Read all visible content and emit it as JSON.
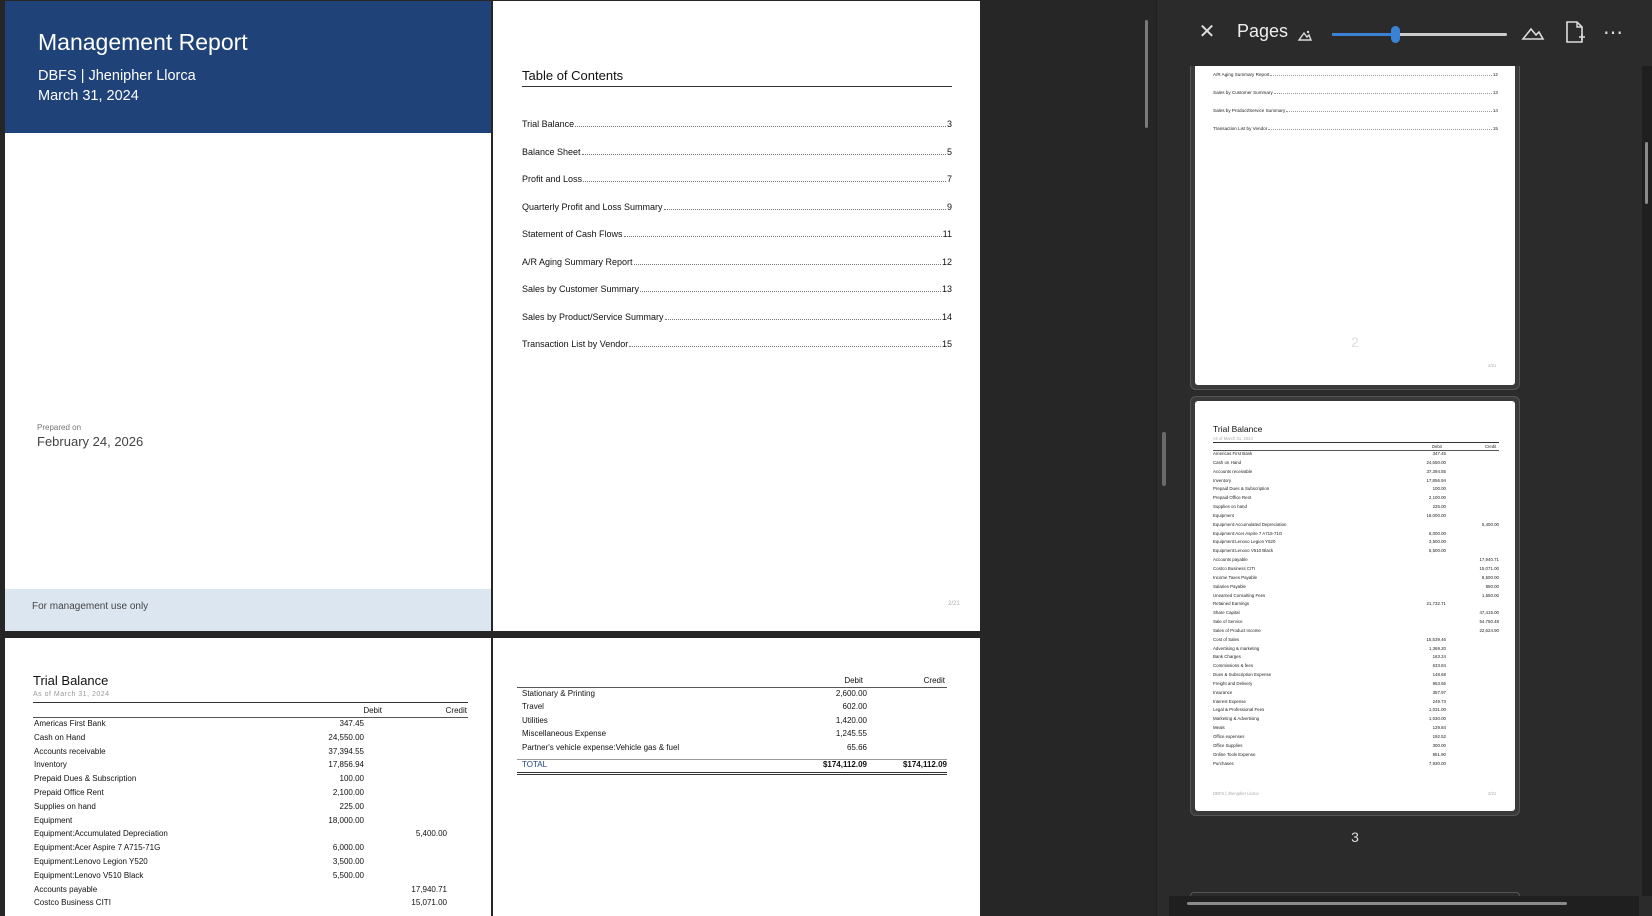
{
  "cover": {
    "title": "Management Report",
    "subtitle": "DBFS | Jhenipher Llorca",
    "date": "March 31, 2024",
    "prepared_label": "Prepared on",
    "prepared_date": "February 24, 2026",
    "footer": "For management use only"
  },
  "toc": {
    "title": "Table of Contents",
    "entries": [
      {
        "label": "Trial Balance",
        "page": "3"
      },
      {
        "label": "Balance Sheet",
        "page": "5"
      },
      {
        "label": "Profit and Loss",
        "page": "7"
      },
      {
        "label": "Quarterly Profit and Loss Summary",
        "page": "9"
      },
      {
        "label": "Statement of Cash Flows",
        "page": "11"
      },
      {
        "label": "A/R Aging Summary Report",
        "page": "12"
      },
      {
        "label": "Sales by Customer Summary",
        "page": "13"
      },
      {
        "label": "Sales by Product/Service Summary",
        "page": "14"
      },
      {
        "label": "Transaction List by Vendor",
        "page": "15"
      }
    ],
    "page_num": "2/21"
  },
  "trial_balance": {
    "title": "Trial Balance",
    "as_of": "As of March 31, 2024",
    "col_debit": "Debit",
    "col_credit": "Credit",
    "rows": [
      {
        "name": "Americas First Bank",
        "debit": "347.45",
        "credit": ""
      },
      {
        "name": "Cash on Hand",
        "debit": "24,550.00",
        "credit": ""
      },
      {
        "name": "Accounts receivable",
        "debit": "37,394.55",
        "credit": ""
      },
      {
        "name": "Inventory",
        "debit": "17,856.94",
        "credit": ""
      },
      {
        "name": "Prepaid Dues & Subscription",
        "debit": "100.00",
        "credit": ""
      },
      {
        "name": "Prepaid Office Rent",
        "debit": "2,100.00",
        "credit": ""
      },
      {
        "name": "Supplies on hand",
        "debit": "225.00",
        "credit": ""
      },
      {
        "name": "Equipment",
        "debit": "18,000.00",
        "credit": ""
      },
      {
        "name": "Equipment:Accumulated Depreciation",
        "debit": "",
        "credit": "5,400.00"
      },
      {
        "name": "Equipment:Acer Aspire 7 A715-71G",
        "debit": "6,000.00",
        "credit": ""
      },
      {
        "name": "Equipment:Lenovo Legion Y520",
        "debit": "3,500.00",
        "credit": ""
      },
      {
        "name": "Equipment:Lenovo V510 Black",
        "debit": "5,500.00",
        "credit": ""
      },
      {
        "name": "Accounts payable",
        "debit": "",
        "credit": "17,940.71"
      },
      {
        "name": "Costco Business CITI",
        "debit": "",
        "credit": "15,071.00"
      }
    ]
  },
  "trial_balance_cont": {
    "col_debit": "Debit",
    "col_credit": "Credit",
    "rows": [
      {
        "name": "Stationary & Printing",
        "debit": "2,600.00",
        "credit": ""
      },
      {
        "name": "Travel",
        "debit": "602.00",
        "credit": ""
      },
      {
        "name": "Utilities",
        "debit": "1,420.00",
        "credit": ""
      },
      {
        "name": "Miscellaneous Expense",
        "debit": "1,245.55",
        "credit": ""
      },
      {
        "name": "Partner's vehicle expense:Vehicle gas & fuel",
        "debit": "65.66",
        "credit": ""
      }
    ],
    "total": {
      "name": "TOTAL",
      "debit": "$174,112.09",
      "credit": "$174,112.09"
    }
  },
  "panel": {
    "title": "Pages",
    "zoom_fraction": 0.36,
    "thumb2_label": "2",
    "thumb3_label": "3",
    "thumb2_entries": [
      {
        "label": "A/R Aging Summary Report",
        "page": "12"
      },
      {
        "label": "Sales by Customer Summary",
        "page": "13"
      },
      {
        "label": "Sales by Product/Service Summary",
        "page": "14"
      },
      {
        "label": "Transaction List by Vendor",
        "page": "15"
      }
    ],
    "thumb2_pagenum": "2/21",
    "thumb3_title": "Trial Balance",
    "thumb3_asof": "As of March 31, 2024",
    "thumb3_debit": "Debit",
    "thumb3_credit": "Credit",
    "thumb3_rows": [
      {
        "name": "Americas First Bank",
        "debit": "347.45",
        "credit": ""
      },
      {
        "name": "Cash on Hand",
        "debit": "24,550.00",
        "credit": ""
      },
      {
        "name": "Accounts receivable",
        "debit": "37,394.55",
        "credit": ""
      },
      {
        "name": "Inventory",
        "debit": "17,856.94",
        "credit": ""
      },
      {
        "name": "Prepaid Dues & Subscription",
        "debit": "100.00",
        "credit": ""
      },
      {
        "name": "Prepaid Office Rent",
        "debit": "2,100.00",
        "credit": ""
      },
      {
        "name": "Supplies on hand",
        "debit": "225.00",
        "credit": ""
      },
      {
        "name": "Equipment",
        "debit": "18,000.00",
        "credit": ""
      },
      {
        "name": "Equipment:Accumulated Depreciation",
        "debit": "",
        "credit": "5,400.00"
      },
      {
        "name": "Equipment:Acer Aspire 7 A715-71G",
        "debit": "6,000.00",
        "credit": ""
      },
      {
        "name": "Equipment:Lenovo Legion Y520",
        "debit": "3,500.00",
        "credit": ""
      },
      {
        "name": "Equipment:Lenovo V510 Black",
        "debit": "5,500.00",
        "credit": ""
      },
      {
        "name": "Accounts payable",
        "debit": "",
        "credit": "17,940.71"
      },
      {
        "name": "Costco Business CITI",
        "debit": "",
        "credit": "15,071.00"
      },
      {
        "name": "Income Taxes Payable",
        "debit": "",
        "credit": "8,500.00"
      },
      {
        "name": "Salaries Payable",
        "debit": "",
        "credit": "850.00"
      },
      {
        "name": "Unearned Consulting Fees",
        "debit": "",
        "credit": "1,550.00"
      },
      {
        "name": "Retained Earnings",
        "debit": "21,732.71",
        "credit": ""
      },
      {
        "name": "Share Capital",
        "debit": "",
        "credit": "47,415.00"
      },
      {
        "name": "Sale of Service",
        "debit": "",
        "credit": "54,750.48"
      },
      {
        "name": "Sales of Product Income",
        "debit": "",
        "credit": "22,624.90"
      },
      {
        "name": "Cost of Sales",
        "debit": "15,539.46",
        "credit": ""
      },
      {
        "name": "Advertising & marketing",
        "debit": "1,369.20",
        "credit": ""
      },
      {
        "name": "Bank Charges",
        "debit": "163.24",
        "credit": ""
      },
      {
        "name": "Commissions & fees",
        "debit": "633.84",
        "credit": ""
      },
      {
        "name": "Dues & Subscription Expense",
        "debit": "148.68",
        "credit": ""
      },
      {
        "name": "Freight and Delivery",
        "debit": "953.65",
        "credit": ""
      },
      {
        "name": "Insurance",
        "debit": "357.97",
        "credit": ""
      },
      {
        "name": "Interest Expense",
        "debit": "249.73",
        "credit": ""
      },
      {
        "name": "Legal & Professional Fees",
        "debit": "1,031.00",
        "credit": ""
      },
      {
        "name": "Marketing & Advertising",
        "debit": "1,030.00",
        "credit": ""
      },
      {
        "name": "Meals",
        "debit": "129.84",
        "credit": ""
      },
      {
        "name": "Office expenses",
        "debit": "192.52",
        "credit": ""
      },
      {
        "name": "Office Supplies",
        "debit": "300.00",
        "credit": ""
      },
      {
        "name": "Online Tools Expense",
        "debit": "851.90",
        "credit": ""
      },
      {
        "name": "Purchases",
        "debit": "7,930.00",
        "credit": ""
      }
    ],
    "thumb3_footer": "DBFS | Jhenipher Llorca",
    "thumb3_pagenum": "3/21"
  }
}
